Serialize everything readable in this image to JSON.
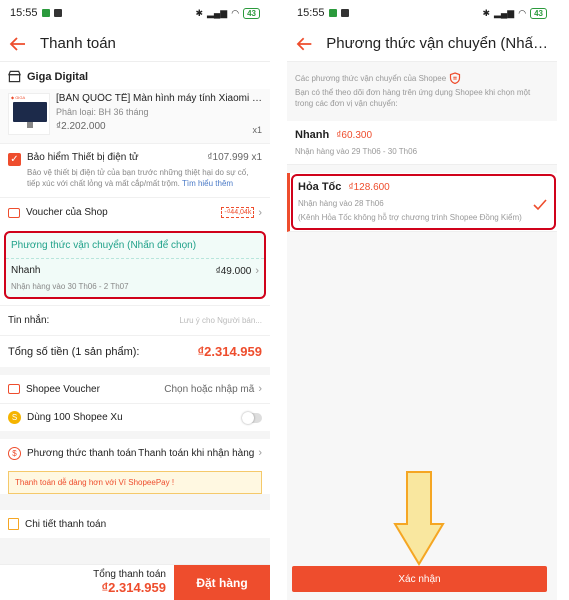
{
  "status": {
    "time": "15:55",
    "battery": "43"
  },
  "left": {
    "title": "Thanh toán",
    "shop": "Giga Digital",
    "product": {
      "name": "[BẢN QUỐC TẾ] Màn hình máy tính Xiaomi 1...",
      "variant": "Phân loại: BH 36 tháng",
      "price": "₫2.202.000",
      "qty": "x1"
    },
    "insurance": {
      "title": "Bảo hiểm Thiết bị điện tử",
      "price": "₫107.999",
      "qty": "x1",
      "desc": "Bảo vệ thiết bị điện tử của bạn trước những thiệt hại do sự cố, tiếp xúc với chất lỏng và mất cắp/mất trộm.",
      "link": "Tìm hiểu thêm"
    },
    "shop_voucher": {
      "label": "Voucher của Shop",
      "badge": "-₫44,04k"
    },
    "shipping": {
      "title": "Phương thức vận chuyển (Nhấn để chọn)",
      "method": "Nhanh",
      "price": "₫49.000",
      "eta": "Nhận hàng vào 30 Th06 - 2 Th07"
    },
    "message": {
      "label": "Tin nhắn:",
      "placeholder": "Lưu ý cho Người bán..."
    },
    "total": {
      "label": "Tổng số tiền (1 sản phẩm):",
      "value": "₫2.314.959"
    },
    "shopee_voucher": {
      "label": "Shopee Voucher",
      "value": "Chọn hoặc nhập mã"
    },
    "xu": {
      "label": "Dùng 100 Shopee Xu"
    },
    "payment": {
      "label": "Phương thức thanh toán",
      "value": "Thanh toán khi nhận hàng"
    },
    "promo": "Thanh toán dễ dàng hơn với Ví ShopeePay !",
    "detail": "Chi tiết thanh toán",
    "bottom": {
      "total_label": "Tổng thanh toán",
      "total_value": "₫2.314.959",
      "order_button": "Đặt hàng"
    }
  },
  "right": {
    "title": "Phương thức vận chuyển (Nhấn ...",
    "hint_title": "Các phương thức vận chuyển của Shopee",
    "hint_desc": "Bạn có thể theo dõi đơn hàng trên ứng dụng Shopee khi chọn một trong các đơn vị vận chuyển:",
    "options": [
      {
        "name": "Nhanh",
        "price": "₫60.300",
        "eta": "Nhận hàng vào 29 Th06 - 30 Th06"
      },
      {
        "name": "Hỏa Tốc",
        "price": "₫128.600",
        "eta": "Nhận hàng vào 28 Th06",
        "note": "(Kênh Hỏa Tốc không hỗ trợ chương trình Shopee Đồng Kiểm)"
      }
    ],
    "confirm_button": "Xác nhận"
  },
  "colors": {
    "accent": "#ee4d2d",
    "highlight_border": "#d0021b",
    "shipping_teal": "#1fa189",
    "arrow_fill": "#f9e79f",
    "arrow_stroke": "#f5a623"
  }
}
